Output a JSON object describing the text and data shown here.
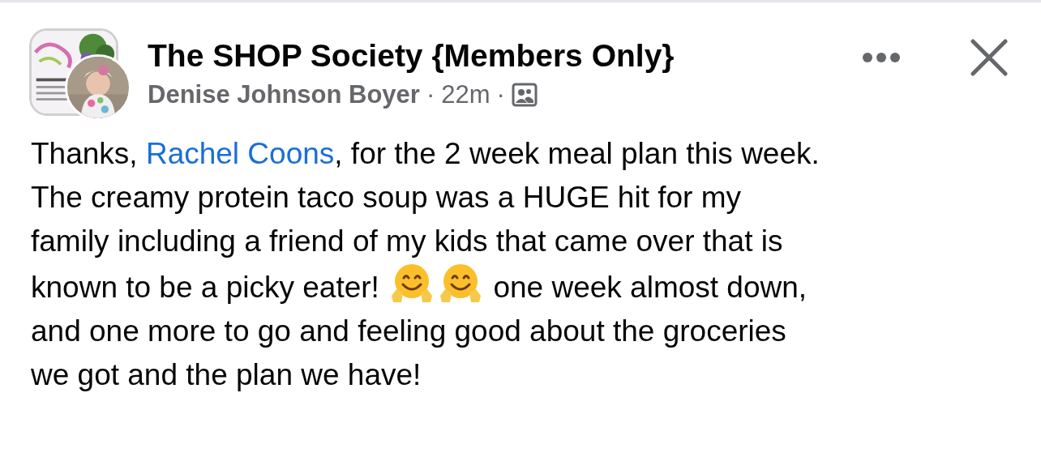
{
  "post": {
    "group_name": "The SHOP Society {Members Only}",
    "author": "Denise Johnson Boyer",
    "separator_1": "·",
    "time": "22m",
    "separator_2": "·",
    "body_lines": [
      [
        {
          "kind": "text",
          "text": "Thanks, "
        },
        {
          "kind": "mention",
          "text": "Rachel Coons"
        },
        {
          "kind": "text",
          "text": ", for the 2 week meal plan this week."
        }
      ],
      [
        {
          "kind": "text",
          "text": "The creamy protein taco soup was a HUGE hit for my"
        }
      ],
      [
        {
          "kind": "text",
          "text": "family including a friend of my kids that came over that is"
        }
      ],
      [
        {
          "kind": "text",
          "text": "known to be a picky eater! "
        },
        {
          "kind": "emoji"
        },
        {
          "kind": "emoji"
        },
        {
          "kind": "text",
          "text": " one week almost down,"
        }
      ],
      [
        {
          "kind": "text",
          "text": "and one more to go and feeling good about the groceries"
        }
      ],
      [
        {
          "kind": "text",
          "text": "we got and the plan we have!"
        }
      ]
    ]
  }
}
